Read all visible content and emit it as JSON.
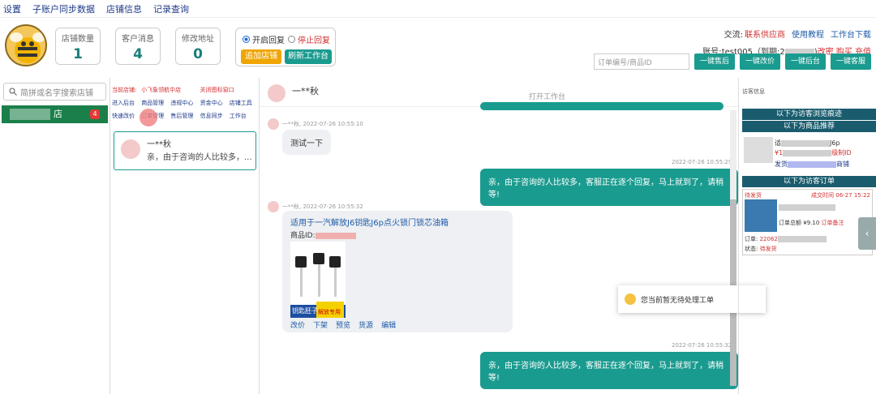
{
  "menu": [
    "设置",
    "子账户同步数据",
    "店铺信息",
    "记录查询"
  ],
  "stats": [
    {
      "label": "店铺数量",
      "value": "1"
    },
    {
      "label": "客户消息",
      "value": "4"
    },
    {
      "label": "修改地址",
      "value": "0"
    }
  ],
  "reply": {
    "on": "开启回复",
    "off": "停止回复",
    "add_shop": "追加店铺",
    "refresh": "刷新工作台"
  },
  "top_right": {
    "prefix": "交流:",
    "contact": "联系供应商",
    "tutorial": "使用教程",
    "download": "工作台下载",
    "account_label": "账号:",
    "account": "test005（到期:2",
    "change_pwd": "改密",
    "buy": "购买",
    "recharge": "充值"
  },
  "tools": {
    "placeholder": "订单编号/商品ID",
    "buttons": [
      "一键售后",
      "一键改价",
      "一键后台",
      "一键客服"
    ]
  },
  "left": {
    "search": "简拼或名字搜索店铺",
    "shop_suffix": "店",
    "badge": "4"
  },
  "links": [
    "当前店铺:",
    "小飞象领航中店",
    "关闭图标窗口",
    "进入后台",
    "商品管理",
    "违规中心",
    "资金中心",
    "店铺工具",
    "快速改价",
    "订单管理",
    "售后管理",
    "信息同步",
    "工作台"
  ],
  "conv": {
    "name": "一**秋",
    "msg": "亲，由于咨询的人比较多，..."
  },
  "chat": {
    "name": "一**秋",
    "workspace": "打开工作台",
    "t1": "一**秋, 2022-07-26 10:55:10",
    "m1": "测试一下",
    "t2": "2022-07-26 10:55:29",
    "m2": "亲，由于咨询的人比较多，客服正在逐个回复，马上就到了，请稍等!",
    "t3": "一**秋, 2022-07-26 10:55:32",
    "prod_title": "适用于一汽解放J6钥匙J6p点火锁门锁芯油箱",
    "prod_id": "商品ID:",
    "prod_tag1": "钥匙胚子",
    "prod_tag2": "解放专用",
    "acts": [
      "改价",
      "下架",
      "预览",
      "货源",
      "编辑"
    ],
    "t4": "2022-07-26 10:55:32",
    "m4": "亲，由于咨询的人比较多，客服正在逐个回复，马上就到了，请稍等!"
  },
  "toast": "您当前暂无待处理工单",
  "right": {
    "header": "访客信息",
    "bar1": "以下为访客浏览痕迹",
    "bar2": "以下为商品推荐",
    "bar3": "以下为访客订单",
    "rec_t1": "适",
    "rec_t1b": "J6p",
    "rec_t2": "¥1",
    "rec_t2b": "级制ID",
    "rec_t3": "发货",
    "rec_t3b": "商铺",
    "order_status": "待发货",
    "order_time": "成交时间 06-27 15:22",
    "order_l2": "订单总额",
    "order_l2b": "¥9.10",
    "order_l2c": "订单备注",
    "order_no": "订单:",
    "order_no_v": "22062",
    "state_label": "状态:",
    "state_val": "待发货"
  }
}
